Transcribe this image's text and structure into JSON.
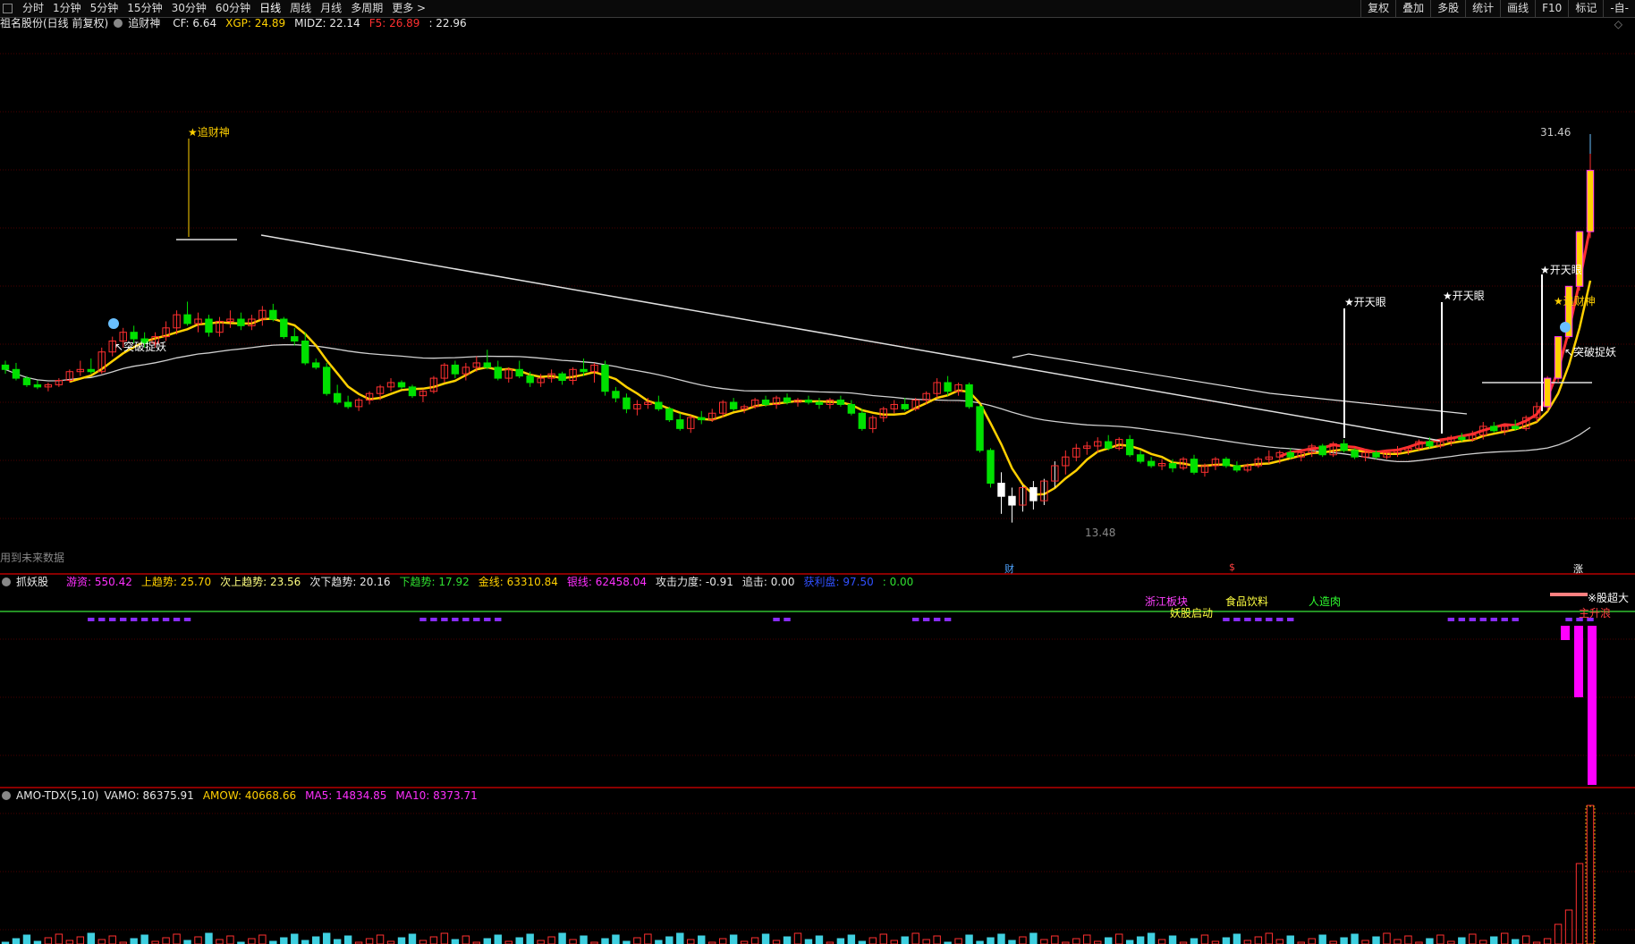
{
  "toolbar": {
    "periods": [
      {
        "label": "分时",
        "active": false
      },
      {
        "label": "1分钟",
        "active": false
      },
      {
        "label": "5分钟",
        "active": false
      },
      {
        "label": "15分钟",
        "active": false
      },
      {
        "label": "30分钟",
        "active": false
      },
      {
        "label": "60分钟",
        "active": false
      },
      {
        "label": "日线",
        "active": true
      },
      {
        "label": "周线",
        "active": false
      },
      {
        "label": "月线",
        "active": false
      },
      {
        "label": "多周期",
        "active": false
      },
      {
        "label": "更多 >",
        "active": false
      }
    ],
    "right_buttons": [
      "复权",
      "叠加",
      "多股",
      "统计",
      "画线",
      "F10",
      "标记",
      "-自-"
    ]
  },
  "main_panel": {
    "title": "祖名股份(日线 前复权)",
    "indicator_name": "追财神",
    "values": [
      {
        "label": "CF: 6.64",
        "color": "#e8e8e8"
      },
      {
        "label": "XGP: 24.89",
        "color": "#ffd000"
      },
      {
        "label": "MIDZ: 22.14",
        "color": "#e8e8e8"
      },
      {
        "label": "F5: 26.89",
        "color": "#ff3030"
      },
      {
        "label": ": 22.96",
        "color": "#e8e8e8"
      }
    ],
    "high_label": "31.46",
    "low_label": "13.48",
    "future_data_note": "用到未来数据",
    "signals": {
      "zhuicaishen": "★追财神",
      "tupo_left": "↖突破捉妖",
      "kaitianyan_1": "★开天眼",
      "kaitianyan_2": "★开天眼",
      "kaitianyan_3": "★开天眼",
      "zhuicaishen_right": "★追财神",
      "tupo_right": "↖突破捉妖"
    },
    "date_markers": [
      {
        "text": "财",
        "color": "#4ea3ff"
      },
      {
        "text": "$",
        "color": "#ff4040"
      },
      {
        "text": "涨",
        "color": "#ffffff"
      }
    ]
  },
  "sub_panel_1": {
    "name": "抓妖股",
    "values": [
      {
        "label": "游资: 550.42",
        "color": "#ff30ff"
      },
      {
        "label": "上趋势: 25.70",
        "color": "#ffd000"
      },
      {
        "label": "次上趋势: 23.56",
        "color": "#ffff80"
      },
      {
        "label": "次下趋势: 20.16",
        "color": "#e8e8e8"
      },
      {
        "label": "下趋势: 17.92",
        "color": "#30e030"
      },
      {
        "label": "金线: 63310.84",
        "color": "#ffd000"
      },
      {
        "label": "银线: 62458.04",
        "color": "#ff30ff"
      },
      {
        "label": "攻击力度: -0.91",
        "color": "#e8e8e8"
      },
      {
        "label": "追击: 0.00",
        "color": "#e8e8e8"
      },
      {
        "label": "获利盘: 97.50",
        "color": "#3050ff"
      },
      {
        "label": ": 0.00",
        "color": "#30e030"
      }
    ],
    "labels": [
      {
        "text": "浙江板块",
        "color": "#ff40ff"
      },
      {
        "text": "妖股启动",
        "color": "#ffff40"
      },
      {
        "text": "食品饮料",
        "color": "#ffff40"
      },
      {
        "text": "人造肉",
        "color": "#30ff30"
      },
      {
        "text": "※股超大",
        "color": "#ffffff"
      },
      {
        "text": "主升浪",
        "color": "#ff4040"
      }
    ]
  },
  "sub_panel_2": {
    "name": "AMO-TDX(5,10)",
    "values": [
      {
        "label": "VAMO: 86375.91",
        "color": "#e8e8e8"
      },
      {
        "label": "AMOW: 40668.66",
        "color": "#ffd000"
      },
      {
        "label": "MA5: 14834.85",
        "color": "#ff30ff"
      },
      {
        "label": "MA10: 8373.71",
        "color": "#ff30ff"
      }
    ]
  },
  "colors": {
    "up": "#ff3030",
    "down": "#00e000",
    "ma_white": "#d0d0d0",
    "ma_yellow": "#ffd000",
    "grid": "#4a0000",
    "divider": "#8a0000"
  },
  "chart_data": {
    "type": "candlestick",
    "price_axis_range": [
      13.48,
      31.46
    ],
    "candles": [
      [
        21.8,
        22.0,
        21.4,
        21.6
      ],
      [
        21.6,
        21.9,
        21.1,
        21.2
      ],
      [
        21.2,
        21.3,
        20.8,
        20.9
      ],
      [
        20.9,
        21.1,
        20.7,
        20.8
      ],
      [
        20.8,
        21.0,
        20.6,
        20.9
      ],
      [
        20.9,
        21.2,
        20.8,
        21.1
      ],
      [
        21.1,
        21.6,
        21.0,
        21.5
      ],
      [
        21.5,
        22.0,
        21.3,
        21.6
      ],
      [
        21.6,
        22.1,
        21.4,
        21.5
      ],
      [
        21.5,
        22.6,
        21.4,
        22.4
      ],
      [
        22.4,
        23.1,
        22.2,
        22.9
      ],
      [
        22.9,
        23.5,
        22.6,
        23.3
      ],
      [
        23.3,
        23.6,
        22.8,
        23.0
      ],
      [
        23.0,
        23.3,
        22.6,
        22.8
      ],
      [
        22.8,
        23.3,
        22.6,
        23.1
      ],
      [
        23.1,
        23.8,
        22.9,
        23.5
      ],
      [
        23.5,
        24.3,
        23.2,
        24.1
      ],
      [
        24.1,
        24.7,
        23.6,
        23.7
      ],
      [
        23.7,
        24.2,
        23.3,
        23.9
      ],
      [
        23.9,
        24.1,
        23.1,
        23.3
      ],
      [
        23.3,
        24.0,
        23.1,
        23.8
      ],
      [
        23.8,
        24.3,
        23.5,
        23.9
      ],
      [
        23.9,
        24.2,
        23.4,
        23.6
      ],
      [
        23.6,
        24.1,
        23.4,
        23.9
      ],
      [
        23.9,
        24.5,
        23.6,
        24.3
      ],
      [
        24.3,
        24.6,
        23.8,
        23.9
      ],
      [
        23.9,
        24.0,
        23.0,
        23.1
      ],
      [
        23.1,
        23.5,
        22.7,
        22.9
      ],
      [
        22.9,
        23.3,
        21.8,
        21.9
      ],
      [
        21.9,
        22.1,
        21.6,
        21.7
      ],
      [
        21.7,
        21.9,
        20.4,
        20.5
      ],
      [
        20.5,
        20.9,
        20.0,
        20.1
      ],
      [
        20.1,
        20.4,
        19.8,
        19.9
      ],
      [
        19.9,
        20.3,
        19.7,
        20.2
      ],
      [
        20.2,
        20.6,
        20.0,
        20.5
      ],
      [
        20.5,
        20.9,
        20.2,
        20.8
      ],
      [
        20.8,
        21.2,
        20.6,
        21.0
      ],
      [
        21.0,
        21.1,
        20.7,
        20.8
      ],
      [
        20.8,
        20.9,
        20.3,
        20.4
      ],
      [
        20.4,
        20.7,
        20.1,
        20.6
      ],
      [
        20.6,
        21.3,
        20.5,
        21.2
      ],
      [
        21.2,
        21.9,
        21.0,
        21.8
      ],
      [
        21.8,
        22.0,
        21.2,
        21.4
      ],
      [
        21.4,
        21.9,
        21.1,
        21.7
      ],
      [
        21.7,
        22.2,
        21.5,
        21.9
      ],
      [
        21.9,
        22.5,
        21.6,
        21.7
      ],
      [
        21.7,
        22.0,
        21.1,
        21.2
      ],
      [
        21.2,
        21.7,
        21.0,
        21.6
      ],
      [
        21.6,
        22.0,
        21.2,
        21.3
      ],
      [
        21.3,
        21.5,
        20.8,
        21.0
      ],
      [
        21.0,
        21.4,
        20.8,
        21.2
      ],
      [
        21.2,
        21.6,
        21.0,
        21.4
      ],
      [
        21.4,
        21.5,
        20.9,
        21.1
      ],
      [
        21.1,
        21.7,
        20.9,
        21.6
      ],
      [
        21.6,
        22.1,
        21.3,
        21.5
      ],
      [
        21.5,
        21.9,
        21.0,
        21.8
      ],
      [
        21.8,
        22.0,
        20.4,
        20.6
      ],
      [
        20.6,
        20.8,
        20.1,
        20.3
      ],
      [
        20.3,
        20.5,
        19.6,
        19.8
      ],
      [
        19.8,
        20.2,
        19.5,
        20.0
      ],
      [
        20.0,
        20.3,
        19.8,
        20.1
      ],
      [
        20.1,
        20.4,
        19.7,
        19.8
      ],
      [
        19.8,
        19.9,
        19.2,
        19.3
      ],
      [
        19.3,
        19.6,
        18.8,
        18.9
      ],
      [
        18.9,
        19.5,
        18.7,
        19.4
      ],
      [
        19.4,
        19.7,
        19.1,
        19.3
      ],
      [
        19.3,
        19.8,
        19.2,
        19.6
      ],
      [
        19.6,
        20.2,
        19.4,
        20.1
      ],
      [
        20.1,
        20.3,
        19.7,
        19.8
      ],
      [
        19.8,
        20.0,
        19.6,
        19.9
      ],
      [
        19.9,
        20.3,
        19.8,
        20.2
      ],
      [
        20.2,
        20.4,
        19.9,
        20.0
      ],
      [
        20.0,
        20.4,
        19.8,
        20.3
      ],
      [
        20.3,
        20.5,
        20.0,
        20.1
      ],
      [
        20.1,
        20.3,
        19.9,
        20.2
      ],
      [
        20.2,
        20.4,
        20.0,
        20.1
      ],
      [
        20.1,
        20.3,
        19.8,
        20.0
      ],
      [
        20.0,
        20.3,
        19.8,
        20.2
      ],
      [
        20.2,
        20.4,
        19.9,
        20.0
      ],
      [
        20.0,
        20.2,
        19.5,
        19.6
      ],
      [
        19.6,
        19.8,
        18.8,
        18.9
      ],
      [
        18.9,
        19.5,
        18.7,
        19.4
      ],
      [
        19.4,
        19.9,
        19.2,
        19.8
      ],
      [
        19.8,
        20.2,
        19.6,
        20.0
      ],
      [
        20.0,
        20.3,
        19.7,
        19.8
      ],
      [
        19.8,
        20.3,
        19.7,
        20.2
      ],
      [
        20.2,
        20.6,
        20.0,
        20.5
      ],
      [
        20.5,
        21.2,
        20.3,
        21.0
      ],
      [
        21.0,
        21.3,
        20.4,
        20.6
      ],
      [
        20.6,
        21.0,
        20.4,
        20.9
      ],
      [
        20.9,
        21.0,
        19.8,
        19.9
      ],
      [
        19.9,
        20.0,
        17.8,
        17.9
      ],
      [
        17.9,
        18.0,
        16.2,
        16.4
      ],
      [
        16.4,
        16.9,
        15.0,
        15.8
      ],
      [
        15.8,
        16.2,
        14.6,
        15.4
      ],
      [
        15.4,
        16.3,
        15.1,
        16.2
      ],
      [
        16.2,
        16.5,
        15.2,
        15.6
      ],
      [
        15.6,
        16.6,
        15.4,
        16.5
      ],
      [
        16.5,
        17.4,
        16.2,
        17.2
      ],
      [
        17.2,
        17.9,
        16.8,
        17.6
      ],
      [
        17.6,
        18.2,
        17.4,
        18.0
      ],
      [
        18.0,
        18.3,
        17.7,
        18.1
      ],
      [
        18.1,
        18.5,
        17.8,
        18.3
      ],
      [
        18.3,
        18.6,
        17.9,
        18.0
      ],
      [
        18.0,
        18.5,
        17.9,
        18.4
      ],
      [
        18.4,
        18.6,
        17.6,
        17.7
      ],
      [
        17.7,
        17.9,
        17.3,
        17.4
      ],
      [
        17.4,
        17.6,
        17.1,
        17.2
      ],
      [
        17.2,
        17.5,
        17.0,
        17.3
      ],
      [
        17.3,
        17.5,
        16.9,
        17.1
      ],
      [
        17.1,
        17.6,
        17.0,
        17.5
      ],
      [
        17.5,
        17.7,
        16.8,
        16.9
      ],
      [
        16.9,
        17.3,
        16.7,
        17.2
      ],
      [
        17.2,
        17.6,
        17.0,
        17.5
      ],
      [
        17.5,
        17.6,
        17.1,
        17.2
      ],
      [
        17.2,
        17.4,
        16.9,
        17.0
      ],
      [
        17.0,
        17.3,
        16.9,
        17.2
      ],
      [
        17.2,
        17.6,
        17.1,
        17.5
      ],
      [
        17.5,
        17.9,
        17.3,
        17.6
      ],
      [
        17.6,
        17.9,
        17.3,
        17.8
      ],
      [
        17.8,
        18.0,
        17.5,
        17.6
      ],
      [
        17.6,
        17.9,
        17.4,
        17.8
      ],
      [
        17.8,
        18.2,
        17.6,
        18.1
      ],
      [
        18.1,
        18.2,
        17.6,
        17.7
      ],
      [
        17.7,
        18.3,
        17.6,
        18.2
      ],
      [
        18.2,
        18.4,
        17.8,
        17.9
      ],
      [
        17.9,
        18.0,
        17.5,
        17.6
      ],
      [
        17.6,
        17.9,
        17.4,
        17.8
      ],
      [
        17.8,
        17.9,
        17.5,
        17.6
      ],
      [
        17.6,
        17.9,
        17.5,
        17.8
      ],
      [
        17.8,
        18.1,
        17.6,
        17.9
      ],
      [
        17.9,
        18.1,
        17.7,
        18.0
      ],
      [
        18.0,
        18.4,
        17.9,
        18.3
      ],
      [
        18.3,
        18.5,
        18.0,
        18.1
      ],
      [
        18.1,
        18.4,
        18.0,
        18.3
      ],
      [
        18.3,
        18.6,
        18.1,
        18.5
      ],
      [
        18.5,
        18.7,
        18.3,
        18.4
      ],
      [
        18.4,
        18.8,
        18.3,
        18.6
      ],
      [
        18.6,
        19.2,
        18.4,
        19.0
      ],
      [
        19.0,
        19.2,
        18.7,
        18.8
      ],
      [
        18.8,
        19.1,
        18.6,
        19.0
      ],
      [
        19.0,
        19.3,
        18.8,
        18.9
      ],
      [
        18.9,
        19.5,
        18.8,
        19.4
      ],
      [
        19.4,
        20.1,
        19.2,
        19.9
      ],
      [
        19.9,
        21.3,
        19.7,
        21.2
      ],
      [
        21.2,
        23.1,
        21.0,
        23.1
      ],
      [
        23.1,
        25.4,
        23.0,
        25.4
      ],
      [
        25.4,
        27.9,
        25.2,
        27.9
      ],
      [
        27.9,
        31.46,
        27.6,
        30.7
      ]
    ]
  }
}
